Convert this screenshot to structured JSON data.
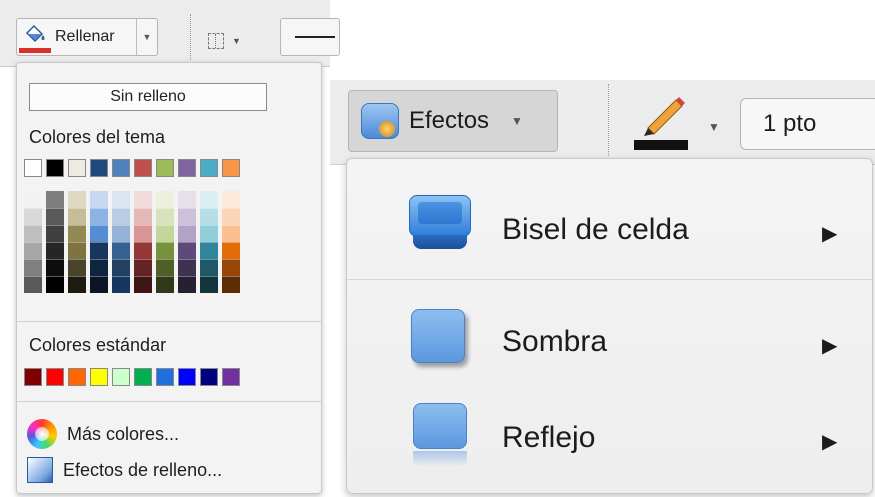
{
  "fill_toolbar": {
    "fill_label": "Rellenar",
    "fill_color": "#d9302b"
  },
  "fill_menu": {
    "no_fill_label": "Sin relleno",
    "theme_colors_label": "Colores del tema",
    "theme_colors": [
      "#ffffff",
      "#000000",
      "#eeece1",
      "#1f497d",
      "#4f81bd",
      "#c0504d",
      "#9bbb59",
      "#8064a2",
      "#4bacc6",
      "#f79646"
    ],
    "theme_shades": [
      [
        "#f2f2f2",
        "#d9d9d9",
        "#bfbfbf",
        "#a6a6a6",
        "#808080",
        "#595959"
      ],
      [
        "#7f7f7f",
        "#595959",
        "#404040",
        "#262626",
        "#0d0d0d",
        "#000000"
      ],
      [
        "#ddd9c3",
        "#c4bd97",
        "#938953",
        "#7f7342",
        "#4a452a",
        "#1d1b10"
      ],
      [
        "#c6d9f0",
        "#8db3e2",
        "#548dd4",
        "#17365d",
        "#0f243e",
        "#0a1626"
      ],
      [
        "#dbe5f1",
        "#b8cce4",
        "#95b3d7",
        "#366092",
        "#244061",
        "#17375e"
      ],
      [
        "#f2dcdb",
        "#e5b9b7",
        "#d99694",
        "#953734",
        "#632423",
        "#3d1514"
      ],
      [
        "#ebf1dd",
        "#d7e3bc",
        "#c3d69b",
        "#76923c",
        "#4f6128",
        "#2f3a18"
      ],
      [
        "#e5e0ec",
        "#ccc1d9",
        "#b2a2c7",
        "#5f497a",
        "#3f3151",
        "#281f33"
      ],
      [
        "#dbeef3",
        "#b7dde8",
        "#92cddc",
        "#31859b",
        "#205867",
        "#12353e"
      ],
      [
        "#fdeada",
        "#fbd5b5",
        "#fac08f",
        "#e36c09",
        "#974806",
        "#5e2c03"
      ]
    ],
    "standard_colors_label": "Colores estándar",
    "standard_colors": [
      "#7f0000",
      "#ff0000",
      "#ff6600",
      "#ffff00",
      "#ccffcc",
      "#00b050",
      "#1f6fe0",
      "#0000ff",
      "#000080",
      "#7030a0"
    ],
    "more_colors_label": "Más colores...",
    "fill_effects_label": "Efectos de relleno..."
  },
  "effects_toolbar": {
    "effects_label": "Efectos",
    "line_weight_value": "1 pto"
  },
  "effects_menu": {
    "items": [
      {
        "label": "Bisel de celda",
        "submenu_arrow": "▶"
      },
      {
        "label": "Sombra",
        "submenu_arrow": "▶"
      },
      {
        "label": "Reflejo",
        "submenu_arrow": "▶"
      }
    ]
  }
}
